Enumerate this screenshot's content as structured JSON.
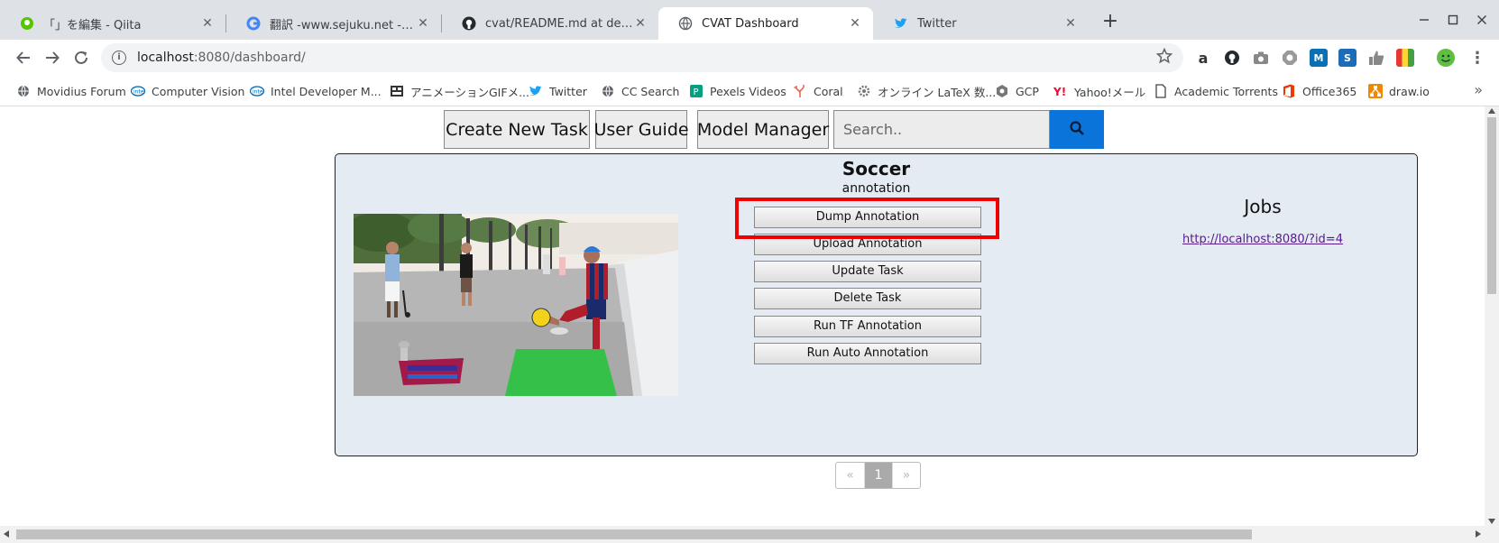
{
  "browser": {
    "tabs": [
      {
        "title": "「」を編集 - Qiita",
        "icon": "qiita-icon",
        "active": false
      },
      {
        "title": "翻訳 -www.sejuku.net - Google 翻訳",
        "icon": "google-icon",
        "active": false
      },
      {
        "title": "cvat/README.md at develop · opencv/cvat",
        "icon": "github-icon",
        "active": false
      },
      {
        "title": "CVAT Dashboard",
        "icon": "globe-icon",
        "active": true
      },
      {
        "title": "Twitter",
        "icon": "twitter-icon",
        "active": false
      }
    ],
    "close_glyph": "✕",
    "new_tab_glyph": "+",
    "url_host": "localhost",
    "url_path": ":8080/dashboard/",
    "bookmarks": [
      {
        "label": "Movidius Forum",
        "icon": "globe-icon"
      },
      {
        "label": "Computer Vision",
        "icon": "intel-icon"
      },
      {
        "label": "Intel Developer M...",
        "icon": "intel-icon"
      },
      {
        "label": "アニメーションGIFメ...",
        "icon": "gif-icon"
      },
      {
        "label": "Twitter",
        "icon": "twitter-icon"
      },
      {
        "label": "CC Search",
        "icon": "globe-icon"
      },
      {
        "label": "Pexels Videos",
        "icon": "pexels-icon"
      },
      {
        "label": "Coral",
        "icon": "coral-icon"
      },
      {
        "label": "オンライン LaTeX 数...",
        "icon": "gear-icon"
      },
      {
        "label": "GCP",
        "icon": "gcp-icon"
      },
      {
        "label": "Yahoo!メール",
        "icon": "yahoo-icon"
      },
      {
        "label": "Academic Torrents",
        "icon": "file-icon"
      },
      {
        "label": "Office365",
        "icon": "office-icon"
      },
      {
        "label": "draw.io",
        "icon": "drawio-icon"
      }
    ],
    "bookmarks_more": "»"
  },
  "dashboard": {
    "create_task_label": "Create New Task",
    "user_guide_label": "User Guide",
    "model_manager_label": "Model Manager",
    "search_placeholder": "Search..",
    "task": {
      "name": "Soccer",
      "mode": "annotation",
      "actions": [
        "Dump Annotation",
        "Upload Annotation",
        "Update Task",
        "Delete Task",
        "Run TF Annotation",
        "Run Auto Annotation"
      ],
      "highlighted_action": "Dump Annotation",
      "jobs_title": "Jobs",
      "job_link": "http://localhost:8080/?id=4"
    },
    "pagination": {
      "prev": "«",
      "current": "1",
      "next": "»"
    }
  },
  "colors": {
    "tab_strip": "#dee1e6",
    "search_button": "#0a74da",
    "task_panel": "#e4ebf3",
    "highlight": "#ee0000",
    "link": "#551a8b"
  }
}
